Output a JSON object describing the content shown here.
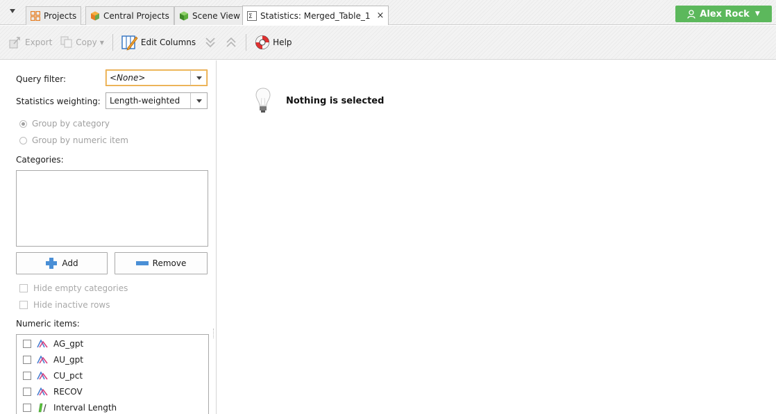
{
  "tabs": [
    {
      "label": "Projects",
      "icon": "projects-icon"
    },
    {
      "label": "Central Projects",
      "icon": "central-projects-icon"
    },
    {
      "label": "Scene View",
      "icon": "scene-view-icon"
    },
    {
      "label": "Statistics: Merged_Table_1",
      "icon": "statistics-icon",
      "active": true,
      "close": "×"
    }
  ],
  "user": {
    "name": "Alex Rock",
    "icon": "user-icon",
    "color": "#5cb85c"
  },
  "toolbar": {
    "export_label": "Export",
    "copy_label": "Copy",
    "edit_columns_label": "Edit Columns",
    "help_label": "Help"
  },
  "form": {
    "query_filter_label": "Query filter:",
    "query_filter_value": "<None>",
    "weighting_label": "Statistics weighting:",
    "weighting_value": "Length-weighted",
    "group_category_label": "Group by category",
    "group_numeric_label": "Group by numeric item",
    "categories_label": "Categories:",
    "add_label": "Add",
    "remove_label": "Remove",
    "hide_empty_label": "Hide empty categories",
    "hide_inactive_label": "Hide inactive rows",
    "numeric_items_label": "Numeric items:"
  },
  "numeric_items": [
    {
      "label": "AG_gpt",
      "icon": "numeric-icon"
    },
    {
      "label": "AU_gpt",
      "icon": "numeric-icon"
    },
    {
      "label": "CU_pct",
      "icon": "numeric-icon"
    },
    {
      "label": "RECOV",
      "icon": "numeric-icon"
    },
    {
      "label": "Interval Length",
      "icon": "interval-length-icon"
    }
  ],
  "content": {
    "empty_message": "Nothing is selected",
    "icon": "lightbulb-icon"
  }
}
